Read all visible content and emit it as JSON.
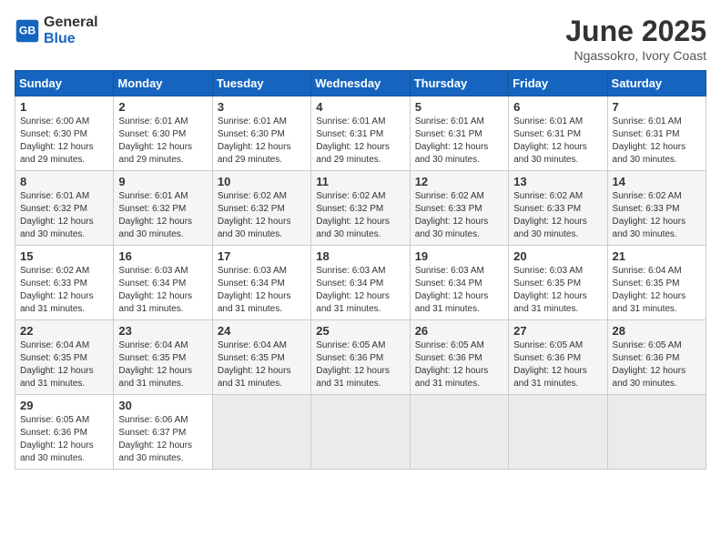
{
  "header": {
    "logo_general": "General",
    "logo_blue": "Blue",
    "title": "June 2025",
    "subtitle": "Ngassokro, Ivory Coast"
  },
  "weekdays": [
    "Sunday",
    "Monday",
    "Tuesday",
    "Wednesday",
    "Thursday",
    "Friday",
    "Saturday"
  ],
  "weeks": [
    [
      {
        "day": "1",
        "sunrise": "6:00 AM",
        "sunset": "6:30 PM",
        "daylight": "12 hours and 29 minutes."
      },
      {
        "day": "2",
        "sunrise": "6:01 AM",
        "sunset": "6:30 PM",
        "daylight": "12 hours and 29 minutes."
      },
      {
        "day": "3",
        "sunrise": "6:01 AM",
        "sunset": "6:30 PM",
        "daylight": "12 hours and 29 minutes."
      },
      {
        "day": "4",
        "sunrise": "6:01 AM",
        "sunset": "6:31 PM",
        "daylight": "12 hours and 29 minutes."
      },
      {
        "day": "5",
        "sunrise": "6:01 AM",
        "sunset": "6:31 PM",
        "daylight": "12 hours and 30 minutes."
      },
      {
        "day": "6",
        "sunrise": "6:01 AM",
        "sunset": "6:31 PM",
        "daylight": "12 hours and 30 minutes."
      },
      {
        "day": "7",
        "sunrise": "6:01 AM",
        "sunset": "6:31 PM",
        "daylight": "12 hours and 30 minutes."
      }
    ],
    [
      {
        "day": "8",
        "sunrise": "6:01 AM",
        "sunset": "6:32 PM",
        "daylight": "12 hours and 30 minutes."
      },
      {
        "day": "9",
        "sunrise": "6:01 AM",
        "sunset": "6:32 PM",
        "daylight": "12 hours and 30 minutes."
      },
      {
        "day": "10",
        "sunrise": "6:02 AM",
        "sunset": "6:32 PM",
        "daylight": "12 hours and 30 minutes."
      },
      {
        "day": "11",
        "sunrise": "6:02 AM",
        "sunset": "6:32 PM",
        "daylight": "12 hours and 30 minutes."
      },
      {
        "day": "12",
        "sunrise": "6:02 AM",
        "sunset": "6:33 PM",
        "daylight": "12 hours and 30 minutes."
      },
      {
        "day": "13",
        "sunrise": "6:02 AM",
        "sunset": "6:33 PM",
        "daylight": "12 hours and 30 minutes."
      },
      {
        "day": "14",
        "sunrise": "6:02 AM",
        "sunset": "6:33 PM",
        "daylight": "12 hours and 30 minutes."
      }
    ],
    [
      {
        "day": "15",
        "sunrise": "6:02 AM",
        "sunset": "6:33 PM",
        "daylight": "12 hours and 31 minutes."
      },
      {
        "day": "16",
        "sunrise": "6:03 AM",
        "sunset": "6:34 PM",
        "daylight": "12 hours and 31 minutes."
      },
      {
        "day": "17",
        "sunrise": "6:03 AM",
        "sunset": "6:34 PM",
        "daylight": "12 hours and 31 minutes."
      },
      {
        "day": "18",
        "sunrise": "6:03 AM",
        "sunset": "6:34 PM",
        "daylight": "12 hours and 31 minutes."
      },
      {
        "day": "19",
        "sunrise": "6:03 AM",
        "sunset": "6:34 PM",
        "daylight": "12 hours and 31 minutes."
      },
      {
        "day": "20",
        "sunrise": "6:03 AM",
        "sunset": "6:35 PM",
        "daylight": "12 hours and 31 minutes."
      },
      {
        "day": "21",
        "sunrise": "6:04 AM",
        "sunset": "6:35 PM",
        "daylight": "12 hours and 31 minutes."
      }
    ],
    [
      {
        "day": "22",
        "sunrise": "6:04 AM",
        "sunset": "6:35 PM",
        "daylight": "12 hours and 31 minutes."
      },
      {
        "day": "23",
        "sunrise": "6:04 AM",
        "sunset": "6:35 PM",
        "daylight": "12 hours and 31 minutes."
      },
      {
        "day": "24",
        "sunrise": "6:04 AM",
        "sunset": "6:35 PM",
        "daylight": "12 hours and 31 minutes."
      },
      {
        "day": "25",
        "sunrise": "6:05 AM",
        "sunset": "6:36 PM",
        "daylight": "12 hours and 31 minutes."
      },
      {
        "day": "26",
        "sunrise": "6:05 AM",
        "sunset": "6:36 PM",
        "daylight": "12 hours and 31 minutes."
      },
      {
        "day": "27",
        "sunrise": "6:05 AM",
        "sunset": "6:36 PM",
        "daylight": "12 hours and 31 minutes."
      },
      {
        "day": "28",
        "sunrise": "6:05 AM",
        "sunset": "6:36 PM",
        "daylight": "12 hours and 30 minutes."
      }
    ],
    [
      {
        "day": "29",
        "sunrise": "6:05 AM",
        "sunset": "6:36 PM",
        "daylight": "12 hours and 30 minutes."
      },
      {
        "day": "30",
        "sunrise": "6:06 AM",
        "sunset": "6:37 PM",
        "daylight": "12 hours and 30 minutes."
      },
      null,
      null,
      null,
      null,
      null
    ]
  ]
}
